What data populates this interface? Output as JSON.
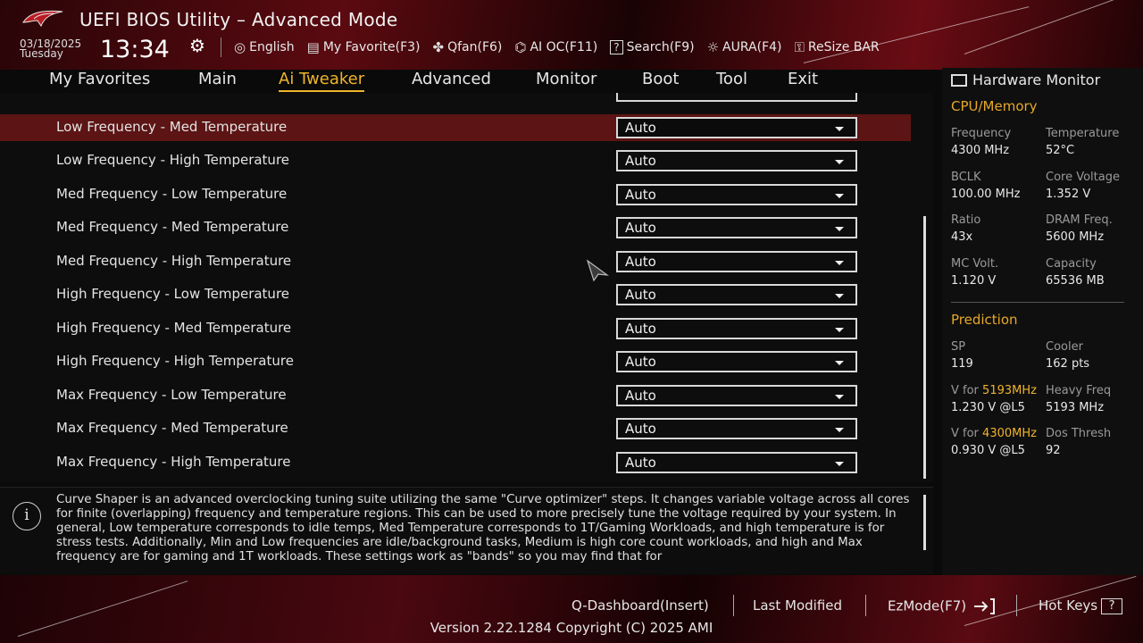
{
  "title": "UEFI BIOS Utility – Advanced Mode",
  "datetime": {
    "date": "03/18/2025",
    "day": "Tuesday",
    "time": "13:34"
  },
  "toolbar": [
    {
      "icon": "globe-icon",
      "glyph": "🌐",
      "label": "English"
    },
    {
      "icon": "favorite-icon",
      "glyph": "▤",
      "label": "My Favorite(F3)"
    },
    {
      "icon": "fan-icon",
      "glyph": "✤",
      "label": "Qfan(F6)"
    },
    {
      "icon": "ai-chip-icon",
      "glyph": "⌬",
      "label": "AI OC(F11)"
    },
    {
      "icon": "search-icon",
      "glyph": "?",
      "label": "Search(F9)"
    },
    {
      "icon": "aura-icon",
      "glyph": "☼",
      "label": "AURA(F4)"
    },
    {
      "icon": "resize-bar-icon",
      "glyph": "⚿",
      "label": "ReSize BAR"
    }
  ],
  "menu": [
    {
      "label": "My Favorites",
      "active": false
    },
    {
      "label": "Main",
      "active": false
    },
    {
      "label": "Ai Tweaker",
      "active": true
    },
    {
      "label": "Advanced",
      "active": false
    },
    {
      "label": "Monitor",
      "active": false
    },
    {
      "label": "Boot",
      "active": false
    },
    {
      "label": "Tool",
      "active": false
    },
    {
      "label": "Exit",
      "active": false
    }
  ],
  "settings": [
    {
      "label": "Low Frequency - Med Temperature",
      "value": "Auto",
      "selected": true
    },
    {
      "label": "Low Frequency - High Temperature",
      "value": "Auto"
    },
    {
      "label": "Med Frequency - Low Temperature",
      "value": "Auto"
    },
    {
      "label": "Med Frequency - Med Temperature",
      "value": "Auto"
    },
    {
      "label": "Med Frequency - High Temperature",
      "value": "Auto"
    },
    {
      "label": "High Frequency - Low Temperature",
      "value": "Auto"
    },
    {
      "label": "High Frequency - Med Temperature",
      "value": "Auto"
    },
    {
      "label": "High Frequency - High Temperature",
      "value": "Auto"
    },
    {
      "label": "Max Frequency - Low Temperature",
      "value": "Auto"
    },
    {
      "label": "Max Frequency - Med Temperature",
      "value": "Auto"
    },
    {
      "label": "Max Frequency - High Temperature",
      "value": "Auto"
    }
  ],
  "info": {
    "icon": "i",
    "text": "Curve Shaper is an advanced overclocking tuning suite utilizing the same \"Curve optimizer\" steps. It changes variable voltage across all cores for finite (overlapping) frequency and temperature regions. This can be used to more precisely tune the voltage required by your system. In general, Low temperature corresponds to idle temps, Med Temperature corresponds to 1T/Gaming Workloads, and high temperature is for stress tests. Additionally, Min and Low frequencies are idle/background tasks, Medium is high core count workloads, and high and Max frequency are for gaming and 1T workloads. These settings work as \"bands\" so you may find that for"
  },
  "hardware_monitor": {
    "title": "Hardware Monitor",
    "cpu_memory": {
      "heading": "CPU/Memory",
      "items": [
        {
          "label": "Frequency",
          "value": "4300 MHz"
        },
        {
          "label": "Temperature",
          "value": "52°C"
        },
        {
          "label": "BCLK",
          "value": "100.00 MHz"
        },
        {
          "label": "Core Voltage",
          "value": "1.352 V"
        },
        {
          "label": "Ratio",
          "value": "43x"
        },
        {
          "label": "DRAM Freq.",
          "value": "5600 MHz"
        },
        {
          "label": "MC Volt.",
          "value": "1.120 V"
        },
        {
          "label": "Capacity",
          "value": "65536 MB"
        }
      ]
    },
    "prediction": {
      "heading": "Prediction",
      "sp_label": "SP",
      "sp_value": "119",
      "cooler_label": "Cooler",
      "cooler_value": "162 pts",
      "v1_prefix": "V for ",
      "v1_freq": "5193MHz",
      "v1_value": "1.230 V @L5",
      "heavy_label": "Heavy Freq",
      "heavy_value": "5193 MHz",
      "v2_prefix": "V for ",
      "v2_freq": "4300MHz",
      "v2_value": "0.930 V @L5",
      "dos_label": "Dos Thresh",
      "dos_value": "92"
    }
  },
  "footer": {
    "qdashboard": "Q-Dashboard(Insert)",
    "last_modified": "Last Modified",
    "ezmode": "EzMode(F7)",
    "hotkeys": "Hot Keys",
    "hotkeys_key": "?",
    "version": "Version 2.22.1284 Copyright (C) 2025 AMI"
  },
  "colors": {
    "accent": "#f0b42a",
    "selected_row": "#5c1414",
    "brand_red": "#6a0c14"
  }
}
